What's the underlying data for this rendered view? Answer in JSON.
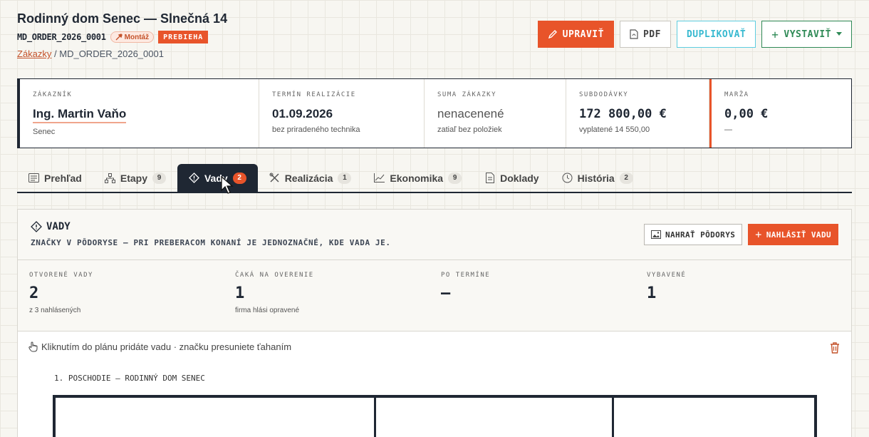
{
  "header": {
    "title": "Rodinný dom Senec — Slnečná 14",
    "order_code": "MD_ORDER_2026_0001",
    "type_tag": "Montáž",
    "status": "PREBIEHA",
    "breadcrumb": {
      "link": "Zákazky",
      "separator": " / ",
      "current": "MD_ORDER_2026_0001"
    }
  },
  "actions": {
    "edit": "UPRAVIŤ",
    "pdf": "PDF",
    "duplicate": "DUPLIKOVAŤ",
    "issue": "VYSTAVIŤ"
  },
  "stats": {
    "customer": {
      "label": "ZÁKAZNÍK",
      "value": "Ing. Martin Vaňo",
      "sub": "Senec"
    },
    "term": {
      "label": "TERMÍN REALIZÁCIE",
      "value": "01.09.2026",
      "sub": "bez priradeného technika"
    },
    "sum": {
      "label": "SUMA ZÁKAZKY",
      "value": "nenacenené",
      "sub": "zatiaľ bez položiek"
    },
    "subcontracts": {
      "label": "SUBDODÁVKY",
      "value": "172 800,00 €",
      "sub": "vyplatené 14 550,00"
    },
    "margin": {
      "label": "MARŽA",
      "value": "0,00 €",
      "sub": "—"
    }
  },
  "tabs": [
    {
      "label": "Prehľad",
      "count": null
    },
    {
      "label": "Etapy",
      "count": "9"
    },
    {
      "label": "Vady",
      "count": "2"
    },
    {
      "label": "Realizácia",
      "count": "1"
    },
    {
      "label": "Ekonomika",
      "count": "9"
    },
    {
      "label": "Doklady",
      "count": null
    },
    {
      "label": "História",
      "count": "2"
    }
  ],
  "defects": {
    "title": "VADY",
    "subtitle": "ZNAČKY V PÔDORYSE — PRI PREBERACOM KONANÍ JE JEDNOZNAČNÉ, KDE VADA JE.",
    "upload_plan": "NAHRAŤ PÔDORYS",
    "report": "NAHLÁSIŤ VADU",
    "kpis": [
      {
        "label": "OTVORENÉ VADY",
        "value": "2",
        "sub": "z 3 nahlásených"
      },
      {
        "label": "ČAKÁ NA OVERENIE",
        "value": "1",
        "sub": "firma hlási opravené"
      },
      {
        "label": "PO TERMÍNE",
        "value": "—",
        "sub": ""
      },
      {
        "label": "VYBAVENÉ",
        "value": "1",
        "sub": ""
      }
    ],
    "hint": "Kliknutím do plánu pridáte vadu · značku presuniete ťahaním",
    "plan_label": "1. POSCHODIE — RODINNÝ DOM SENEC"
  },
  "colors": {
    "accent": "#e8542a",
    "ink": "#1f2733",
    "duplicate": "#38b9d0",
    "issue": "#2f8a56"
  }
}
